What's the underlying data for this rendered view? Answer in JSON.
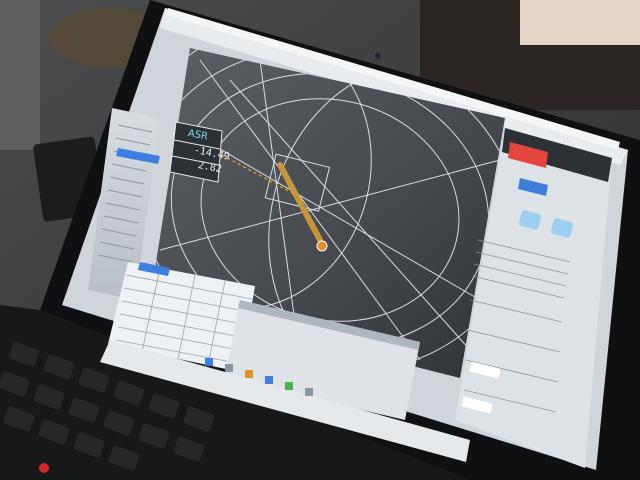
{
  "overlay": {
    "label": "ASR",
    "value1": "-14.49",
    "value2": "2.82"
  }
}
